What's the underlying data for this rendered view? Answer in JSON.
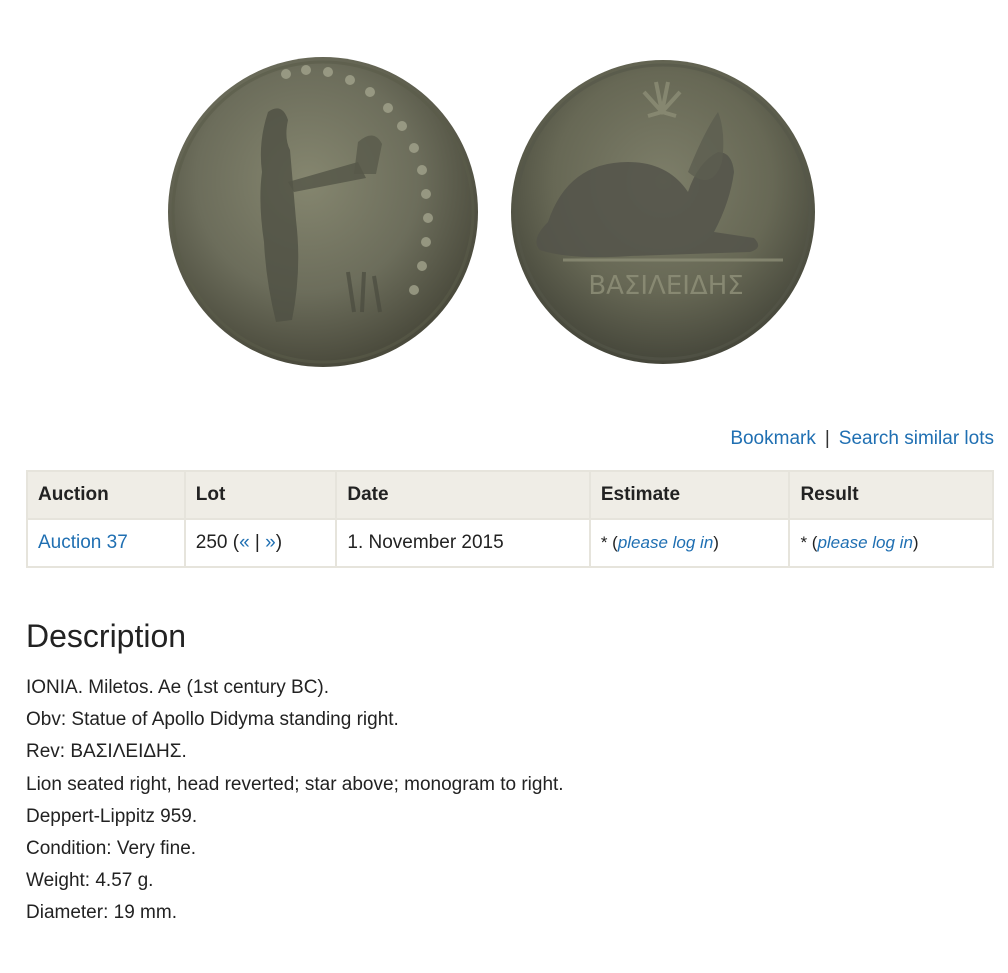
{
  "images": {
    "obverse_inscription": "",
    "reverse_inscription": "ΒΑΣΙΛΕΙΔΗΣ"
  },
  "actions": {
    "bookmark": "Bookmark",
    "separator": "|",
    "search_similar": "Search similar lots"
  },
  "table": {
    "headers": {
      "auction": "Auction",
      "lot": "Lot",
      "date": "Date",
      "estimate": "Estimate",
      "result": "Result"
    },
    "row": {
      "auction": "Auction 37",
      "lot_number": "250 (",
      "prev": "«",
      "lot_sep": " | ",
      "next": "»",
      "lot_close": ")",
      "date": "1. November 2015",
      "estimate_prefix": "* (",
      "estimate_link": "please log in",
      "estimate_suffix": ")",
      "result_prefix": "* (",
      "result_link": "please log in",
      "result_suffix": ")"
    }
  },
  "description": {
    "title": "Description",
    "lines": [
      "IONIA. Miletos. Ae (1st century BC).",
      "Obv: Statue of Apollo Didyma standing right.",
      "Rev: ΒΑΣΙΛΕΙΔΗΣ.",
      "Lion seated right, head reverted; star above; monogram to right.",
      "Deppert-Lippitz 959.",
      "Condition: Very fine.",
      "Weight: 4.57 g.",
      "Diameter: 19 mm."
    ]
  },
  "colors": {
    "link": "#1f6fb2",
    "header_bg": "#efede6",
    "border": "#e6e4dc",
    "coin_base": "#6f705f"
  }
}
